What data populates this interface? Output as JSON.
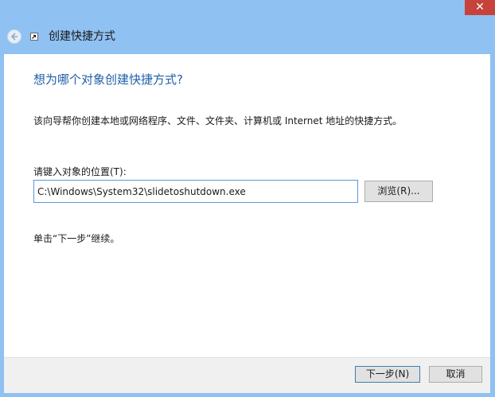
{
  "window": {
    "title": "创建快捷方式",
    "close_glyph": "✕",
    "icons": [
      "back-arrow-icon",
      "shortcut-wizard-icon",
      "close-icon"
    ]
  },
  "page": {
    "heading": "想为哪个对象创建快捷方式?",
    "description": "该向导帮你创建本地或网络程序、文件、文件夹、计算机或 Internet 地址的快捷方式。",
    "location_label": "请键入对象的位置(T):",
    "location_value": "C:\\Windows\\System32\\slidetoshutdown.exe",
    "browse_label": "浏览(R)...",
    "hint": "单击“下一步”继续。"
  },
  "footer": {
    "next_label": "下一步(N)",
    "cancel_label": "取消"
  },
  "colors": {
    "frame": "#8fc1f2",
    "close_button": "#c7423a",
    "heading": "#1f5fa8",
    "input_border": "#5b97d9"
  }
}
